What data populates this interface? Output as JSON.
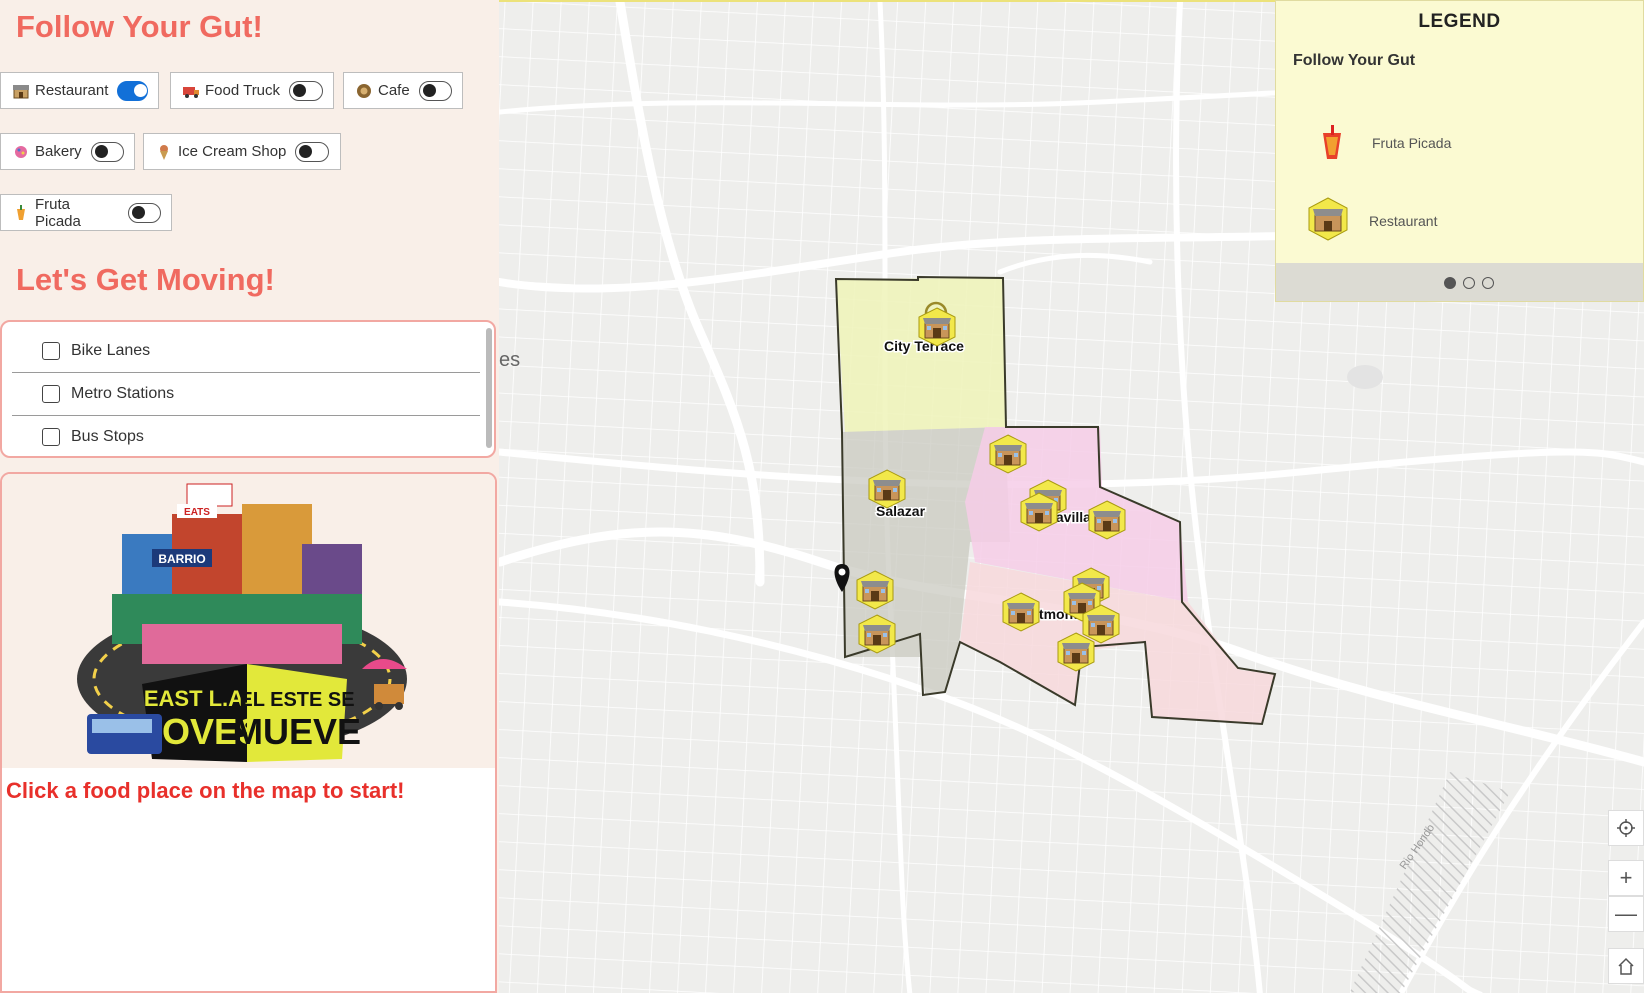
{
  "sidebar": {
    "title": "Follow Your Gut!",
    "filters": [
      {
        "label": "Restaurant",
        "icon": "restaurant-icon",
        "on": true
      },
      {
        "label": "Food Truck",
        "icon": "food-truck-icon",
        "on": false
      },
      {
        "label": "Cafe",
        "icon": "cafe-icon",
        "on": false
      },
      {
        "label": "Bakery",
        "icon": "bakery-icon",
        "on": false
      },
      {
        "label": "Ice Cream Shop",
        "icon": "ice-cream-icon",
        "on": false
      },
      {
        "label": "Fruta Picada",
        "icon": "fruta-picada-icon",
        "on": false
      }
    ],
    "subtitle": "Let's Get Moving!",
    "layers": [
      {
        "label": "Bike Lanes",
        "checked": false
      },
      {
        "label": "Metro Stations",
        "checked": false
      },
      {
        "label": "Bus Stops",
        "checked": false
      }
    ],
    "artwork": {
      "label_left_1": "EAST L.A.",
      "label_left_2": "MOVES",
      "label_right_1": "EL ESTE SE",
      "label_right_2": "MUEVE",
      "sign_1": "BARRIO",
      "sign_2": "EATS"
    },
    "call_to_action": "Click a food place on the map to start!"
  },
  "map": {
    "neighborhoods": [
      "City Terrace",
      "Salazar",
      "Maravilla",
      "Eastmont"
    ],
    "partial_label": "es",
    "street_label": "Rio Hondo"
  },
  "legend": {
    "title": "LEGEND",
    "layer_name": "Follow Your Gut",
    "items": [
      {
        "label": "Fruta Picada",
        "icon": "fruta-picada-icon"
      },
      {
        "label": "Restaurant",
        "icon": "restaurant-icon"
      }
    ],
    "pages": 3,
    "active_page": 1
  },
  "controls": {
    "locate": "crosshair-icon",
    "zoom_in": "+",
    "zoom_out": "—",
    "home": "home-icon"
  },
  "colors": {
    "accent_red": "#f06a60",
    "cta_red": "#e8302b",
    "toggle_on": "#1270d8",
    "legend_bg": "#fbfad2",
    "zone_yellow": "#eef3b8",
    "zone_pink": "#f6cde8",
    "zone_gray": "#c9c9c0"
  }
}
